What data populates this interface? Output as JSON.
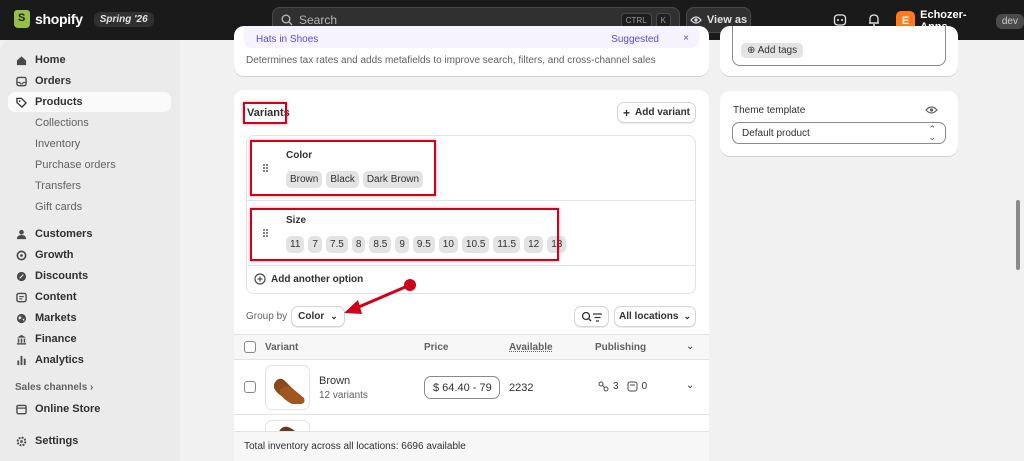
{
  "topbar": {
    "brand": "shopify",
    "release_badge": "Spring '26",
    "search_placeholder": "Search",
    "shortcut_keys": [
      "CTRL",
      "K"
    ],
    "view_as_label": "View as",
    "store_initial": "E",
    "store_name": "Echozer-Apps",
    "store_env": "dev"
  },
  "sidebar": {
    "items": [
      {
        "label": "Home",
        "icon": "home-icon"
      },
      {
        "label": "Orders",
        "icon": "inbox-icon"
      },
      {
        "label": "Products",
        "icon": "tag-icon"
      },
      {
        "label": "Collections"
      },
      {
        "label": "Inventory"
      },
      {
        "label": "Purchase orders"
      },
      {
        "label": "Transfers"
      },
      {
        "label": "Gift cards"
      },
      {
        "label": "Customers",
        "icon": "person-icon"
      },
      {
        "label": "Growth",
        "icon": "growth-icon"
      },
      {
        "label": "Discounts",
        "icon": "discount-icon"
      },
      {
        "label": "Content",
        "icon": "content-icon"
      },
      {
        "label": "Markets",
        "icon": "globe-icon"
      },
      {
        "label": "Finance",
        "icon": "bank-icon"
      },
      {
        "label": "Analytics",
        "icon": "bar-chart-icon"
      }
    ],
    "sales_channels_label": "Sales channels",
    "online_store_label": "Online Store",
    "settings_label": "Settings"
  },
  "category_card": {
    "truncated_left": "Hats in Shoes",
    "truncated_right": "Suggested",
    "description": "Determines tax rates and adds metafields to improve search, filters, and cross-channel sales"
  },
  "variants_card": {
    "title": "Variants",
    "add_variant_label": "Add variant",
    "options": [
      {
        "name": "Color",
        "values": [
          "Brown",
          "Black",
          "Dark Brown"
        ]
      },
      {
        "name": "Size",
        "values": [
          "11",
          "7",
          "7.5",
          "8",
          "8.5",
          "9",
          "9.5",
          "10",
          "10.5",
          "11.5",
          "12",
          "13"
        ]
      }
    ],
    "add_option_label": "Add another option",
    "group_by_label": "Group by",
    "group_by_value": "Color",
    "locations_label": "All locations",
    "columns": [
      "Variant",
      "Price",
      "Available",
      "Publishing"
    ],
    "rows": [
      {
        "name": "Brown",
        "sub": "12 variants",
        "price": "$ 64.40 - 79",
        "available": "2232",
        "publishing_markets": "3",
        "publishing_catalogs": "0"
      }
    ],
    "footer": "Total inventory across all locations: 6696 available"
  },
  "tags_card": {
    "add_tags_label": "Add tags"
  },
  "theme_card": {
    "label": "Theme template",
    "value": "Default product"
  },
  "colors": {
    "topbar": "#1a1a1a",
    "annotation_red": "#d0021b",
    "shopify_green": "#95bf47"
  }
}
